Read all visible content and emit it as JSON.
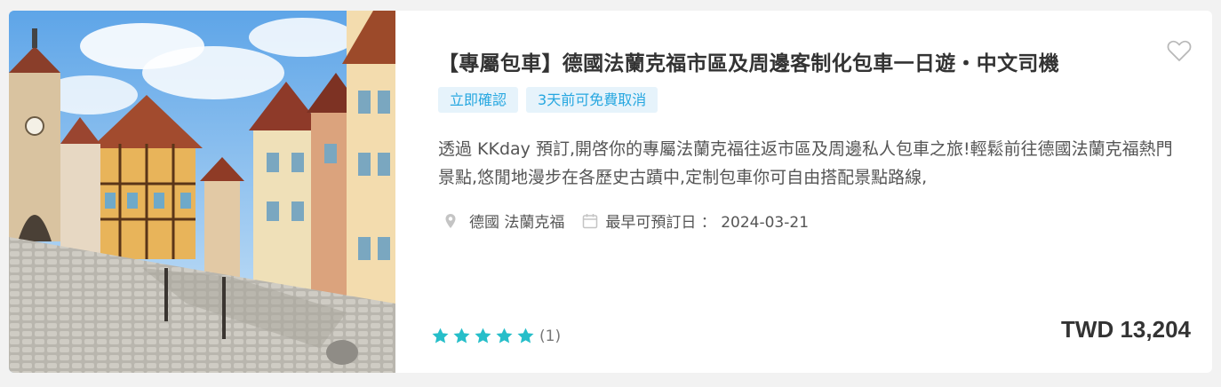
{
  "product": {
    "title": "【專屬包車】德國法蘭克福市區及周邊客制化包車一日遊・中文司機",
    "tags": [
      "立即確認",
      "3天前可免費取消"
    ],
    "description": "透過 KKday 預訂,開啓你的專屬法蘭克福往返市區及周邊私人包車之旅!輕鬆前往德國法蘭克福熱門景點,悠閒地漫步在各歷史古蹟中,定制包車你可自由搭配景點路線,",
    "location": "德國 法蘭克福",
    "earliest_booking": "最早可預訂日 ： 2024-03-21",
    "rating": {
      "stars": 5,
      "count_label": "(1)"
    },
    "price": "TWD 13,204"
  },
  "icons": {
    "favorite": "heart-outline-icon",
    "location": "map-pin-icon",
    "calendar": "calendar-icon",
    "star": "star-icon"
  },
  "colors": {
    "tag_bg": "#e6f3fb",
    "tag_text": "#26a7e0",
    "star": "#26bec9",
    "title": "#333333"
  }
}
